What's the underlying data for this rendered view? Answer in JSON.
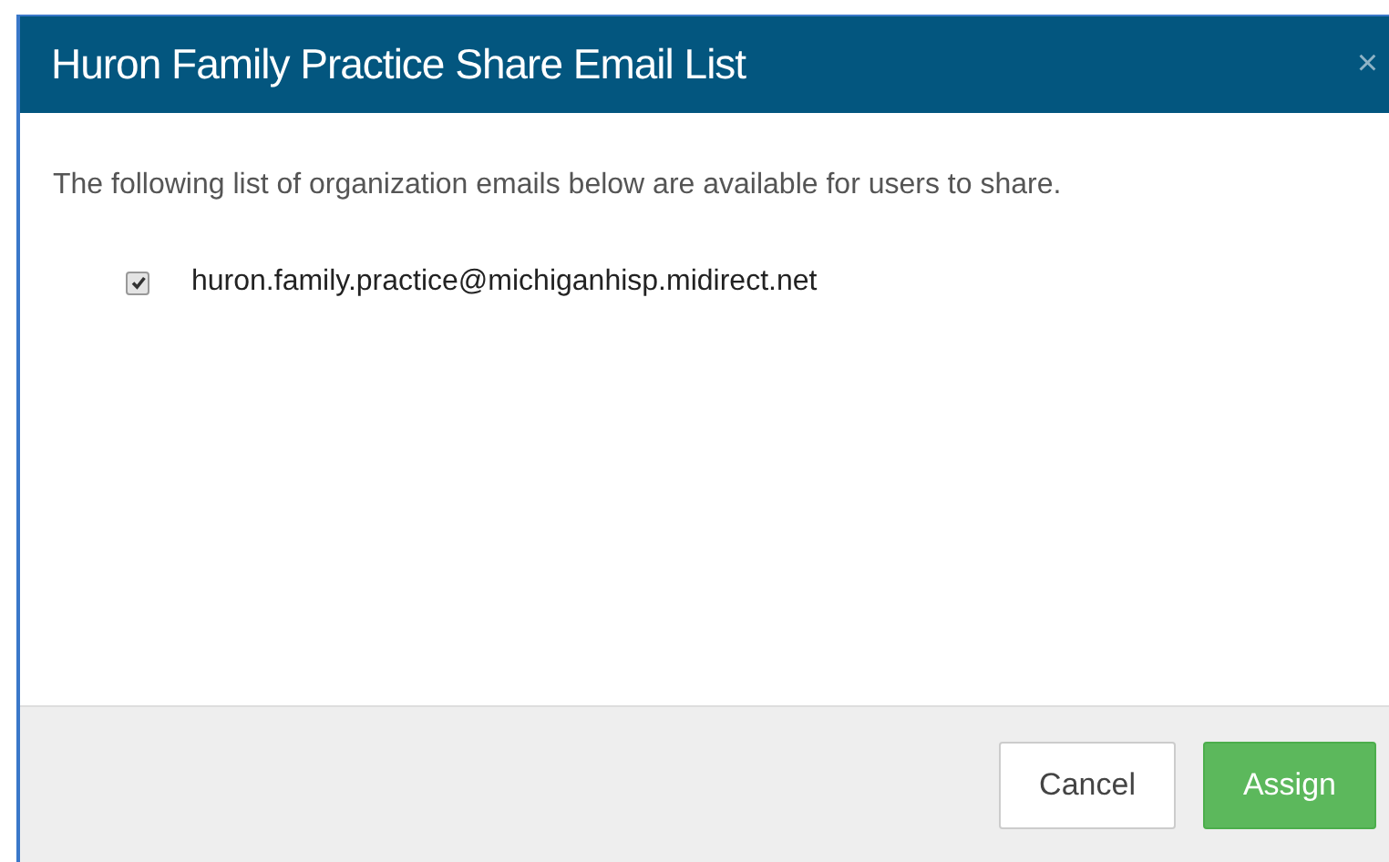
{
  "dialog": {
    "title": "Huron Family Practice Share Email List",
    "close": "×",
    "description": "The following list of organization emails below are available for users to share.",
    "emails": [
      {
        "address": "huron.family.practice@michiganhisp.midirect.net",
        "checked": true
      }
    ],
    "buttons": [
      {
        "label": "Cancel",
        "kind": "default"
      },
      {
        "label": "Assign",
        "kind": "primary"
      }
    ]
  }
}
